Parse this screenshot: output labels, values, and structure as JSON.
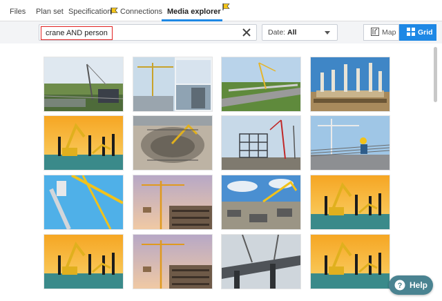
{
  "tabs": [
    {
      "label": "Files"
    },
    {
      "label": "Plan set"
    },
    {
      "label": "Specification"
    },
    {
      "label": "Connections"
    },
    {
      "label": "Media explorer"
    }
  ],
  "active_tab": "Media explorer",
  "search": {
    "value": "crane AND person"
  },
  "date_filter": {
    "label": "Date:",
    "value": "All"
  },
  "view_toggle": {
    "map_label": "Map",
    "grid_label": "Grid",
    "selected": "Grid"
  },
  "help_button": {
    "label": "Help"
  },
  "colors": {
    "accent": "#1e88e5",
    "help_button": "#4a8391",
    "search_highlight": "#e02020",
    "flag": "#f5c518"
  },
  "media_items": [
    {
      "scene": "site-fence"
    },
    {
      "scene": "tower-crane-collage"
    },
    {
      "scene": "bridge-highway"
    },
    {
      "scene": "concrete-columns"
    },
    {
      "scene": "excavators-sunset"
    },
    {
      "scene": "foundation-pit"
    },
    {
      "scene": "steel-frame-cranes"
    },
    {
      "scene": "rebar-worker"
    },
    {
      "scene": "blue-sky-crane"
    },
    {
      "scene": "tower-crane-building"
    },
    {
      "scene": "aerial-site"
    },
    {
      "scene": "excavators-sunset"
    },
    {
      "scene": "excavators-sunset"
    },
    {
      "scene": "tower-crane-building"
    },
    {
      "scene": "bridge-girder"
    },
    {
      "scene": "excavators-sunset"
    }
  ]
}
